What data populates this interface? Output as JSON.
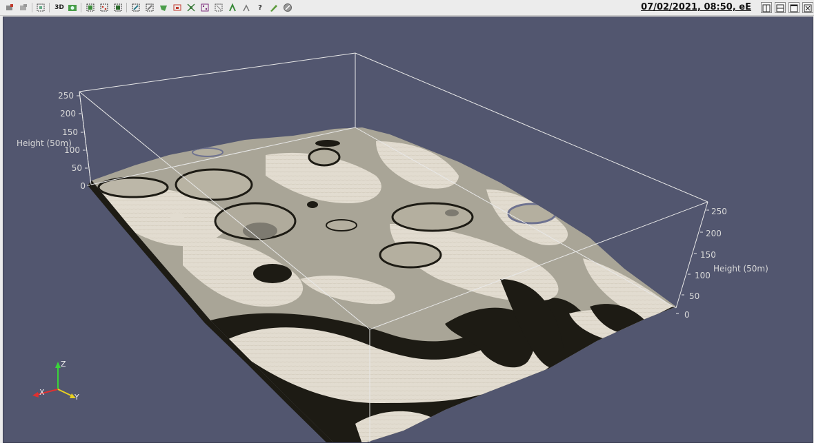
{
  "window": {
    "title": "07/02/2021, 08:50, eE"
  },
  "toolbar": {
    "buttons": [
      {
        "name": "reset-camera-icon"
      },
      {
        "name": "zoom-to-data-icon"
      },
      {
        "name": "zoom-to-box-icon"
      },
      {
        "name": "3d-toggle-button",
        "label": "3D"
      },
      {
        "name": "capture-screenshot-icon"
      },
      {
        "name": "select-cells-on-icon"
      },
      {
        "name": "select-points-on-icon"
      },
      {
        "name": "select-cells-through-icon"
      },
      {
        "name": "select-points-through-icon"
      },
      {
        "name": "select-cells-polygon-icon"
      },
      {
        "name": "select-points-polygon-icon"
      },
      {
        "name": "interactive-select-cells-icon"
      },
      {
        "name": "interactive-select-points-icon"
      },
      {
        "name": "hover-points-icon"
      },
      {
        "name": "hover-cells-icon"
      },
      {
        "name": "grow-selection-icon"
      },
      {
        "name": "shrink-selection-icon"
      },
      {
        "name": "query-button",
        "label": "?"
      },
      {
        "name": "edit-annotation-icon"
      },
      {
        "name": "clear-selection-icon"
      }
    ]
  },
  "axes": {
    "left": {
      "title": "Height (50m)",
      "ticks": [
        "250",
        "200",
        "150",
        "100",
        "50",
        "0"
      ]
    },
    "right": {
      "title": "Height (50m)",
      "ticks": [
        "250",
        "200",
        "150",
        "100",
        "50",
        "0"
      ]
    }
  },
  "orientation": {
    "x": "X",
    "y": "Y",
    "z": "Z"
  },
  "colors": {
    "background": "#52566f",
    "surface_light": "#e2dcd0",
    "surface_mid": "#a9a597",
    "surface_dark": "#1d1b14"
  }
}
